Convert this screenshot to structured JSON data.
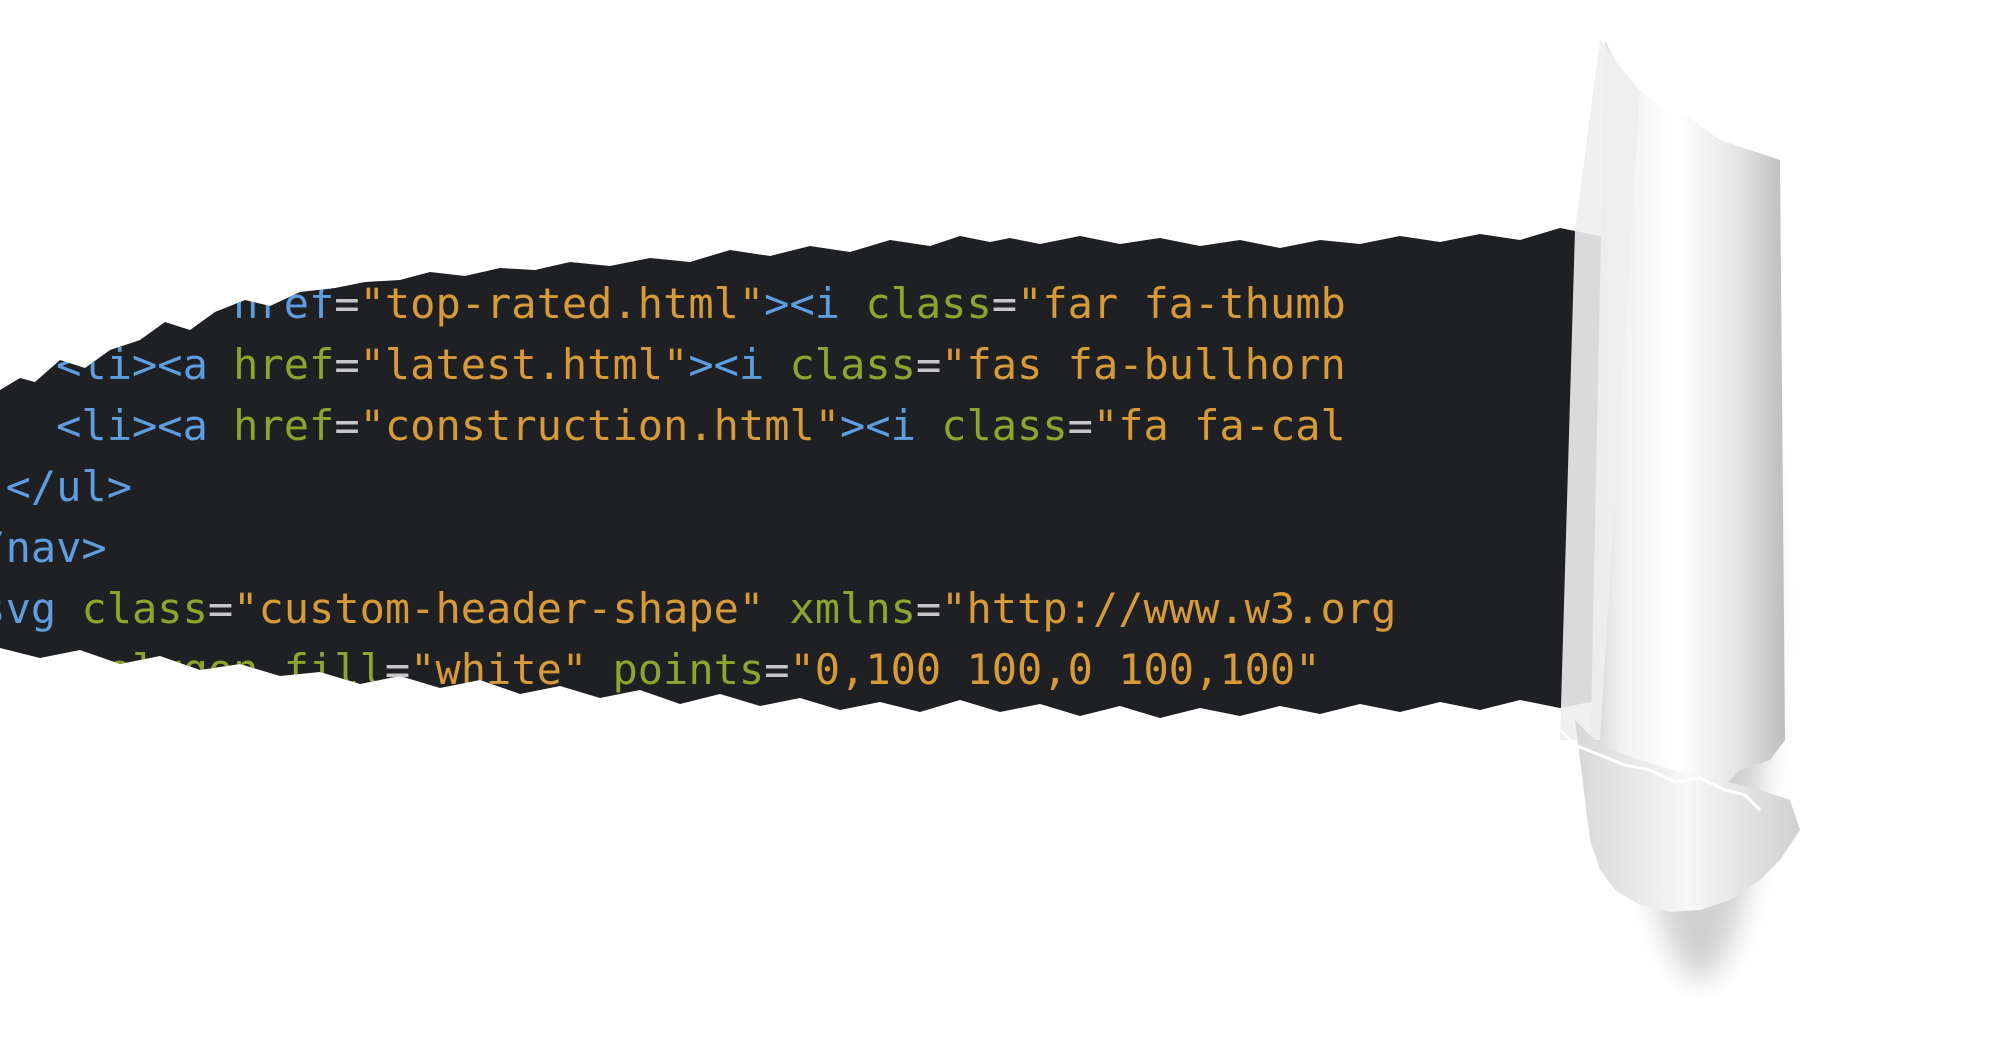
{
  "colors": {
    "background": "#ffffff",
    "code_background": "#1f2023",
    "tag": "#5d9de0",
    "attribute": "#8ca52e",
    "string": "#d79a38",
    "punctuation": "#c8c8c8"
  },
  "code_lines": [
    [
      {
        "t": "    <li><a href",
        "k": "tag"
      },
      {
        "t": "=",
        "k": "punctuation"
      },
      {
        "t": "\"top-rated.html\"",
        "k": "string"
      },
      {
        "t": "><i ",
        "k": "tag"
      },
      {
        "t": "class",
        "k": "attribute"
      },
      {
        "t": "=",
        "k": "punctuation"
      },
      {
        "t": "\"far fa-thumb",
        "k": "string"
      }
    ],
    [
      {
        "t": "    <li><a ",
        "k": "tag"
      },
      {
        "t": "href",
        "k": "attribute"
      },
      {
        "t": "=",
        "k": "punctuation"
      },
      {
        "t": "\"latest.html\"",
        "k": "string"
      },
      {
        "t": "><i ",
        "k": "tag"
      },
      {
        "t": "class",
        "k": "attribute"
      },
      {
        "t": "=",
        "k": "punctuation"
      },
      {
        "t": "\"fas fa-bullhorn",
        "k": "string"
      }
    ],
    [
      {
        "t": "    <li><a ",
        "k": "tag"
      },
      {
        "t": "href",
        "k": "attribute"
      },
      {
        "t": "=",
        "k": "punctuation"
      },
      {
        "t": "\"construction.html\"",
        "k": "string"
      },
      {
        "t": "><i ",
        "k": "tag"
      },
      {
        "t": "class",
        "k": "attribute"
      },
      {
        "t": "=",
        "k": "punctuation"
      },
      {
        "t": "\"fa fa-cal",
        "k": "string"
      }
    ],
    [
      {
        "t": "  </ul>",
        "k": "tag"
      }
    ],
    [
      {
        "t": "</nav>",
        "k": "tag"
      }
    ],
    [
      {
        "t": "<svg ",
        "k": "tag"
      },
      {
        "t": "class",
        "k": "attribute"
      },
      {
        "t": "=",
        "k": "punctuation"
      },
      {
        "t": "\"custom-header-shape\" ",
        "k": "string"
      },
      {
        "t": "xmlns",
        "k": "attribute"
      },
      {
        "t": "=",
        "k": "punctuation"
      },
      {
        "t": "\"http://www.w3.org",
        "k": "string"
      }
    ],
    [
      {
        "t": "    <polygon fill",
        "k": "attribute"
      },
      {
        "t": "=",
        "k": "punctuation"
      },
      {
        "t": "\"white\" ",
        "k": "string"
      },
      {
        "t": "points",
        "k": "attribute"
      },
      {
        "t": "=",
        "k": "punctuation"
      },
      {
        "t": "\"0,100 100,0 100,100\"",
        "k": "string"
      }
    ]
  ]
}
